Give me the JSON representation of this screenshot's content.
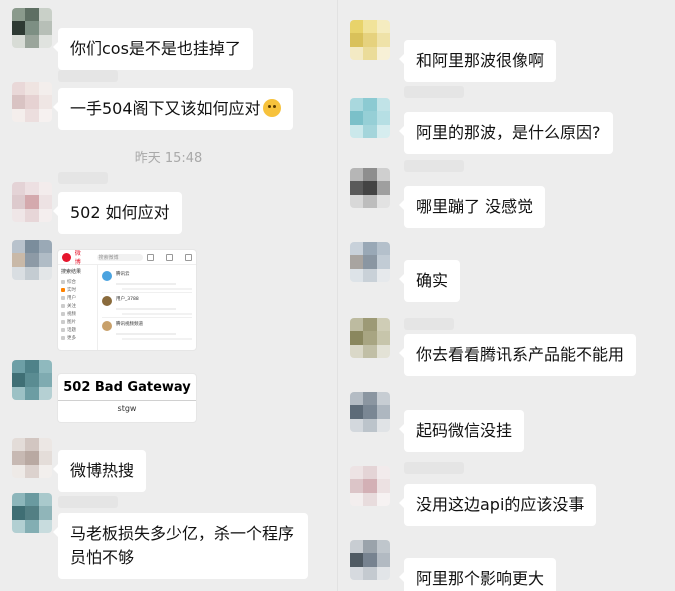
{
  "left_chat": {
    "messages": [
      {
        "text": "你们cos是不是也挂掉了"
      },
      {
        "text": "一手504阁下又该如何应对"
      },
      {
        "text": "502 如何应对"
      },
      {
        "text": "微博热搜"
      },
      {
        "text": "马老板损失多少亿，杀一个程序员怕不够"
      }
    ],
    "timestamp": "昨天 15:48",
    "error_image": {
      "title": "502 Bad Gateway",
      "subtitle": "stgw"
    },
    "weibo_image": {
      "logo_text": "微博",
      "search_placeholder": "搜索微博",
      "side_title": "搜索结果",
      "side_items": [
        "综合",
        "实时",
        "用户",
        "关注",
        "视频",
        "图片",
        "话题",
        "更多"
      ],
      "posts": [
        "腾讯云",
        "用户_3788",
        "腾讯视频频道"
      ]
    }
  },
  "right_chat": {
    "messages": [
      {
        "text": "和阿里那波很像啊"
      },
      {
        "text": "阿里的那波，是什么原因?"
      },
      {
        "text": "哪里蹦了 没感觉"
      },
      {
        "text": "确实"
      },
      {
        "text": "你去看看腾讯系产品能不能用"
      },
      {
        "text": "起码微信没挂"
      },
      {
        "text": "没用这边api的应该没事"
      },
      {
        "text": "阿里那个影响更大"
      }
    ]
  },
  "colors": {
    "background": "#ededed",
    "bubble": "#ffffff",
    "timestamp": "#a9a9a9",
    "weibo_red": "#e6162d"
  }
}
